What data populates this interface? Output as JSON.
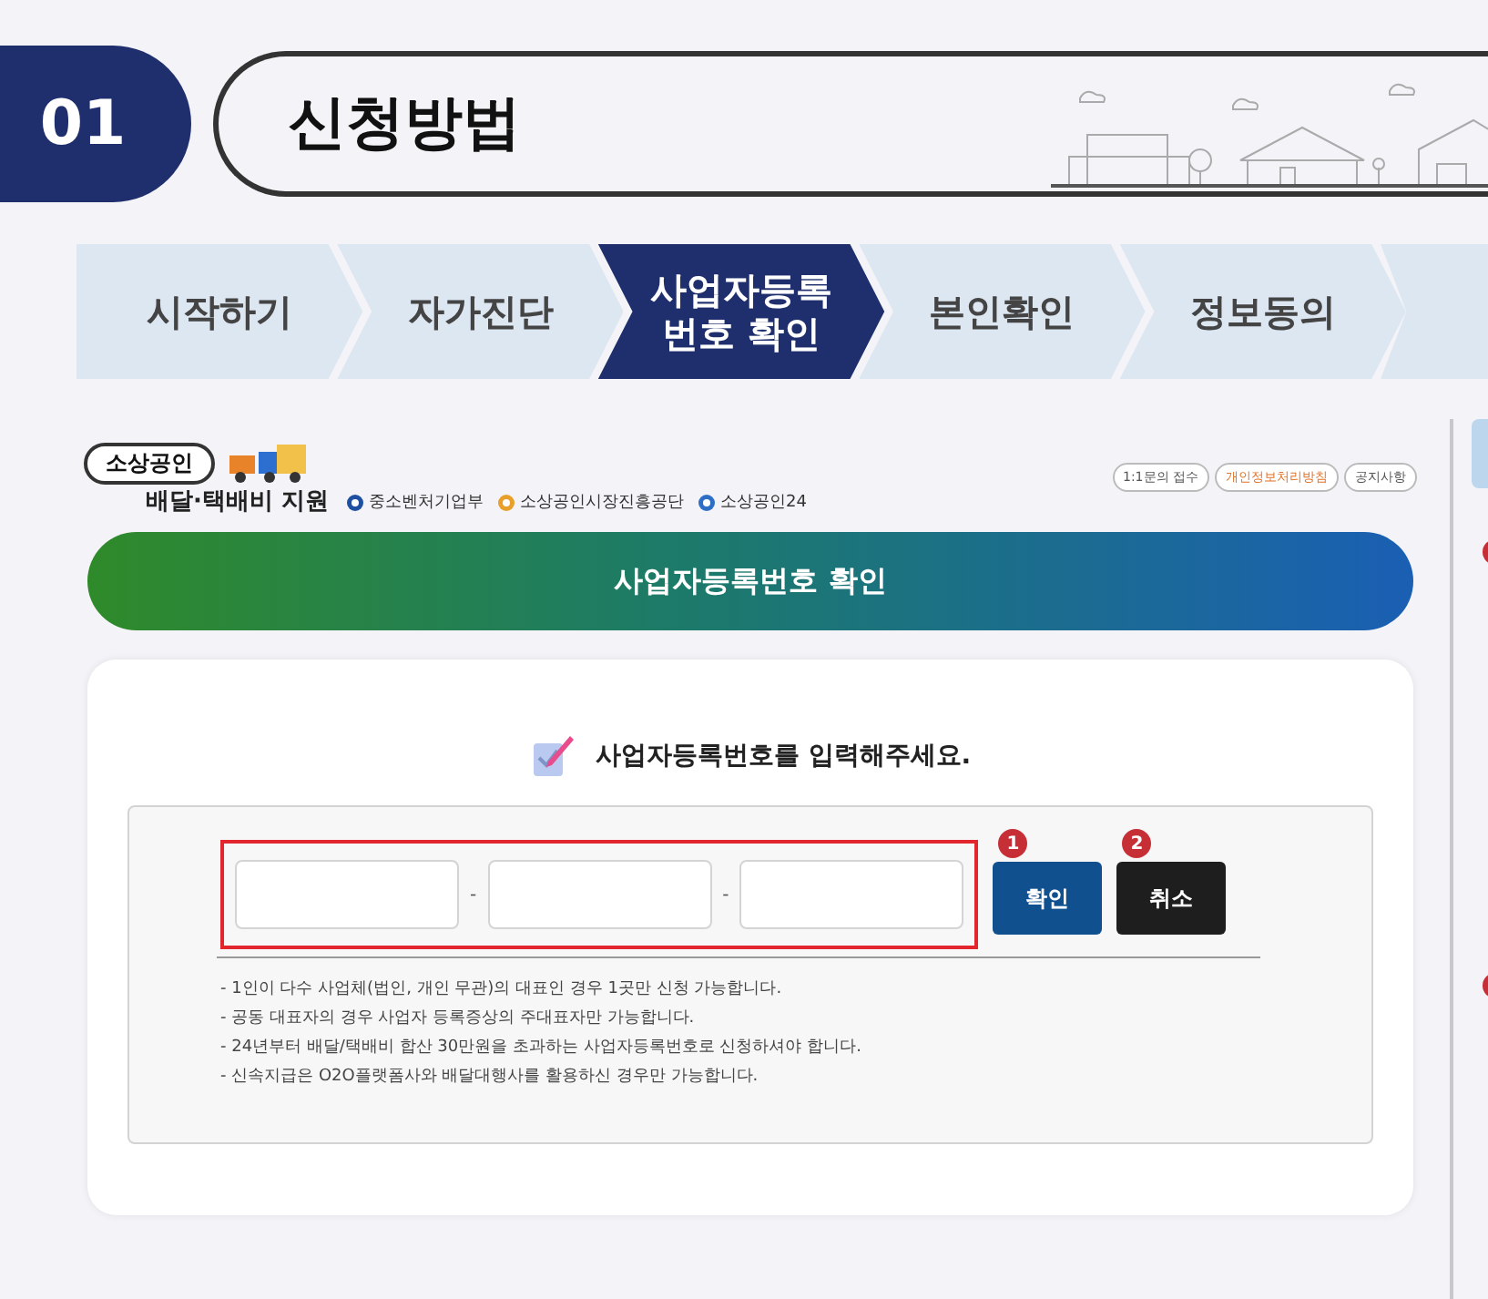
{
  "header": {
    "number": "01",
    "title": "신청방법"
  },
  "steps": [
    {
      "label": "시작하기",
      "selected": false
    },
    {
      "label": "자가진단",
      "selected": false
    },
    {
      "label": "사업자등록\n번호 확인",
      "selected": true
    },
    {
      "label": "본인확인",
      "selected": false
    },
    {
      "label": "정보동의",
      "selected": false
    }
  ],
  "logo": {
    "badge": "소상공인",
    "subtitle": "배달·택배비 지원"
  },
  "agencies": [
    "중소벤처기업부",
    "소상공인시장진흥공단",
    "소상공인24"
  ],
  "links": [
    {
      "label": "1:1문의 접수",
      "kind": "plain"
    },
    {
      "label": "개인정보처리방침",
      "kind": "accent"
    },
    {
      "label": "공지사항",
      "kind": "plain"
    }
  ],
  "banner": "사업자등록번호 확인",
  "prompt": "사업자등록번호를 입력해주세요.",
  "separators": [
    "-",
    "-"
  ],
  "buttons": [
    {
      "label": "확인",
      "badge": "1",
      "kind": "primary"
    },
    {
      "label": "취소",
      "badge": "2",
      "kind": "secondary"
    }
  ],
  "notes": [
    "- 1인이 다수 사업체(법인, 개인 무관)의 대표인 경우 1곳만 신청 가능합니다.",
    "- 공동 대표자의 경우 사업자 등록증상의 주대표자만 가능합니다.",
    "- 24년부터 배달/택배비 합산 30만원을 초과하는 사업자등록번호로 신청하셔야 합니다.",
    "- 신속지급은 O2O플랫폼사와 배달대행사를 활용하신 경우만 가능합니다."
  ]
}
